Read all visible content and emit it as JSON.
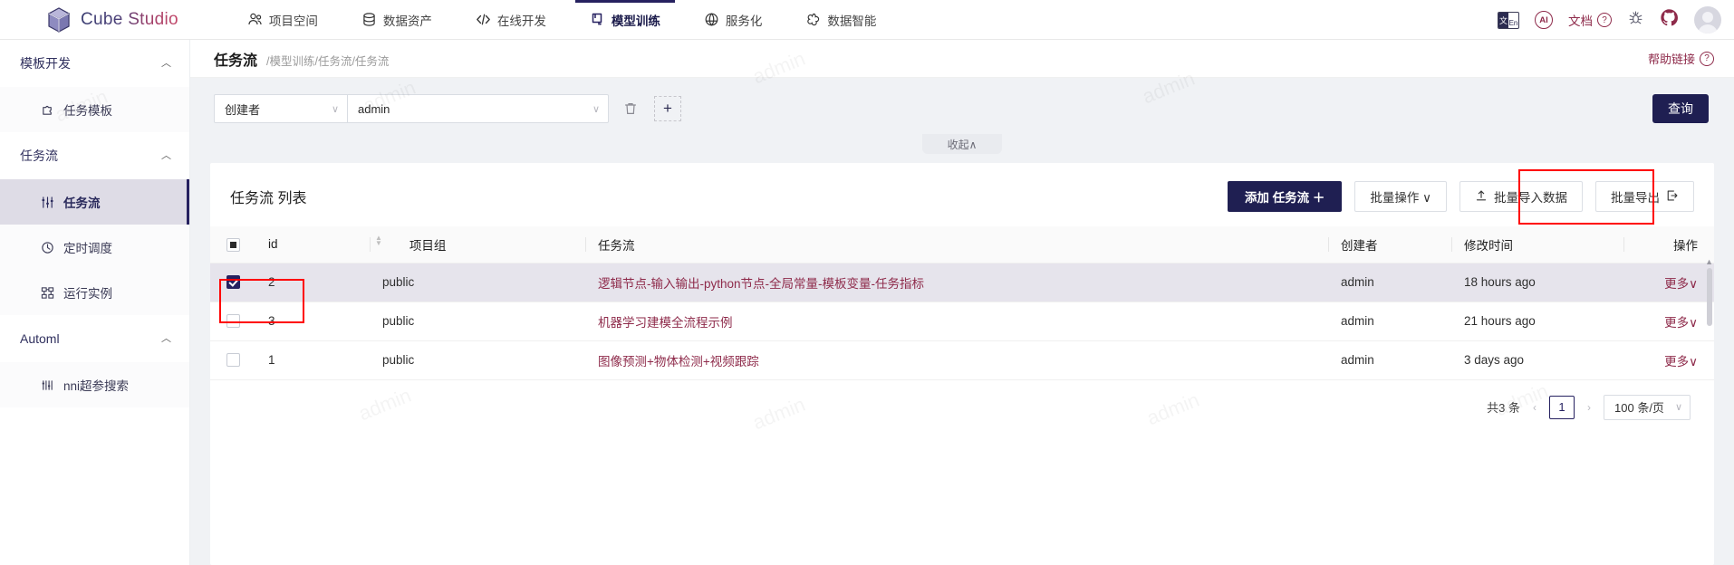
{
  "brand": {
    "name": "Cube Studio"
  },
  "topnav": {
    "items": [
      {
        "label": "项目空间",
        "icon": "users-icon",
        "active": false
      },
      {
        "label": "数据资产",
        "icon": "database-icon",
        "active": false
      },
      {
        "label": "在线开发",
        "icon": "code-icon",
        "active": false
      },
      {
        "label": "模型训练",
        "icon": "flask-icon",
        "active": true
      },
      {
        "label": "服务化",
        "icon": "globe-icon",
        "active": false
      },
      {
        "label": "数据智能",
        "icon": "spiral-icon",
        "active": false
      }
    ],
    "right": {
      "translate_left": "文",
      "translate_right": "En",
      "ai_badge": "AI",
      "doc_label": "文档",
      "question_mark": "?",
      "bug_icon": "bug-icon",
      "github_icon": "github-icon"
    }
  },
  "sidebar": {
    "groups": [
      {
        "title": "模板开发",
        "items": [
          {
            "label": "任务模板",
            "icon": "puzzle-icon",
            "active": false
          }
        ]
      },
      {
        "title": "任务流",
        "items": [
          {
            "label": "任务流",
            "icon": "sliders-icon",
            "active": true
          },
          {
            "label": "定时调度",
            "icon": "clock-icon",
            "active": false
          },
          {
            "label": "运行实例",
            "icon": "sitemap-icon",
            "active": false
          }
        ]
      },
      {
        "title": "Automl",
        "items": [
          {
            "label": "nni超参搜索",
            "icon": "tune-icon",
            "active": false
          }
        ]
      }
    ]
  },
  "breadcrumb": {
    "title": "任务流",
    "path": "/模型训练/任务流/任务流",
    "help_label": "帮助链接"
  },
  "filter": {
    "field_value": "创建者",
    "value_value": "admin",
    "delete_icon": "trash-icon",
    "add_label": "+",
    "query_label": "查询",
    "collapse_label": "收起∧"
  },
  "table_card": {
    "title": "任务流 列表",
    "buttons": {
      "add": "添加 任务流  ＋",
      "batch_op": "批量操作 ∨",
      "batch_import": "批量导入数据",
      "batch_export": "批量导出"
    },
    "columns": [
      "id",
      "项目组",
      "任务流",
      "创建者",
      "修改时间",
      "操作"
    ],
    "rows": [
      {
        "checked": true,
        "id": "2",
        "project": "public",
        "flow": "逻辑节点-输入输出-python节点-全局常量-模板变量-任务指标",
        "creator": "admin",
        "modified": "18 hours ago",
        "action": "更多∨"
      },
      {
        "checked": false,
        "id": "3",
        "project": "public",
        "flow": "机器学习建模全流程示例",
        "creator": "admin",
        "modified": "21 hours ago",
        "action": "更多∨"
      },
      {
        "checked": false,
        "id": "1",
        "project": "public",
        "flow": "图像预测+物体检测+视频跟踪",
        "creator": "admin",
        "modified": "3 days ago",
        "action": "更多∨"
      }
    ]
  },
  "pagination": {
    "total_text": "共3 条",
    "prev": "‹",
    "next": "›",
    "current_page": "1",
    "page_size": "100 条/页"
  },
  "watermark_text": "admin",
  "colors": {
    "primary": "#1f1f52",
    "accent": "#8e2a4a",
    "highlight": "#ff0000",
    "selected_row": "#e6e4ec"
  }
}
